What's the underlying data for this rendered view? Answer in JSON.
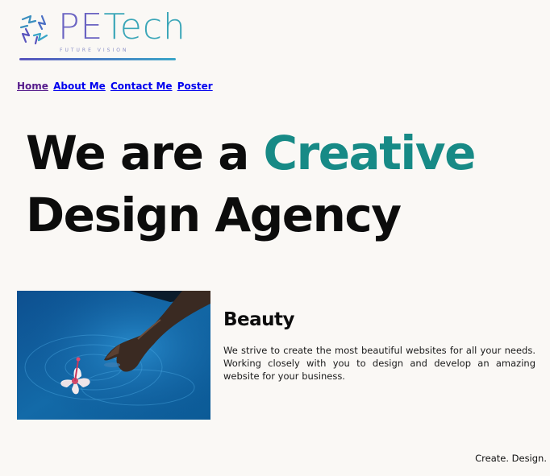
{
  "logo": {
    "brand_prefix": "PE",
    "brand_suffix": "Tech",
    "tagline": "FUTURE VISION"
  },
  "nav": {
    "items": [
      {
        "label": "Home"
      },
      {
        "label": "About Me"
      },
      {
        "label": "Contact Me"
      },
      {
        "label": "Poster"
      }
    ]
  },
  "hero": {
    "line1_start": "We are a ",
    "line1_accent": "Creative",
    "line2": "Design Agency"
  },
  "feature": {
    "title": "Beauty",
    "body": "We strive to create the most beautiful websites for all your needs. Working closely with you to design and develop an amazing website for your business."
  },
  "footer": {
    "note": "Create. Design."
  },
  "colors": {
    "background": "#faf8f5",
    "accent": "#178a86",
    "link": "#0000ee",
    "link_visited": "#551a8b",
    "logo_purple": "#6a63c2",
    "logo_teal": "#3ba6b8"
  }
}
